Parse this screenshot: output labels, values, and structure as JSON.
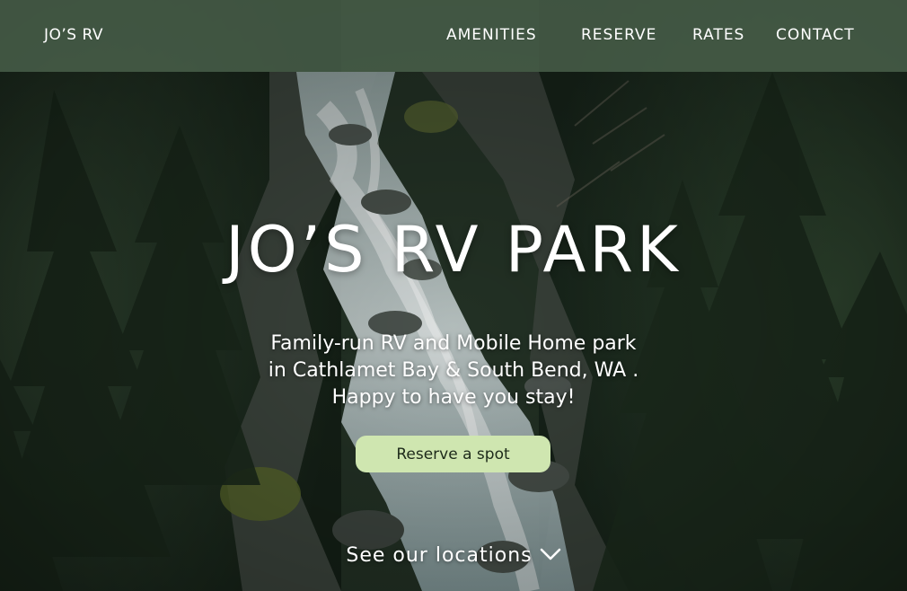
{
  "nav": {
    "brand": "JO’S RV",
    "links": [
      {
        "label": "AMENITIES"
      },
      {
        "label": "RESERVE"
      },
      {
        "label": "RATES"
      },
      {
        "label": "CONTACT"
      }
    ]
  },
  "hero": {
    "title": "JO’S RV PARK",
    "subtitle_lines": [
      "Family-run RV and Mobile Home park",
      "in Cathlamet Bay & South Bend, WA .",
      "Happy to have you stay!"
    ],
    "cta_label": "Reserve a spot",
    "locations_label": "See our locations",
    "locations_icon": "chevron-down-icon"
  },
  "colors": {
    "nav_background": "#4a624c",
    "cta_background": "#cfe6b0",
    "cta_text": "#1d2a1a",
    "text": "#ffffff"
  }
}
